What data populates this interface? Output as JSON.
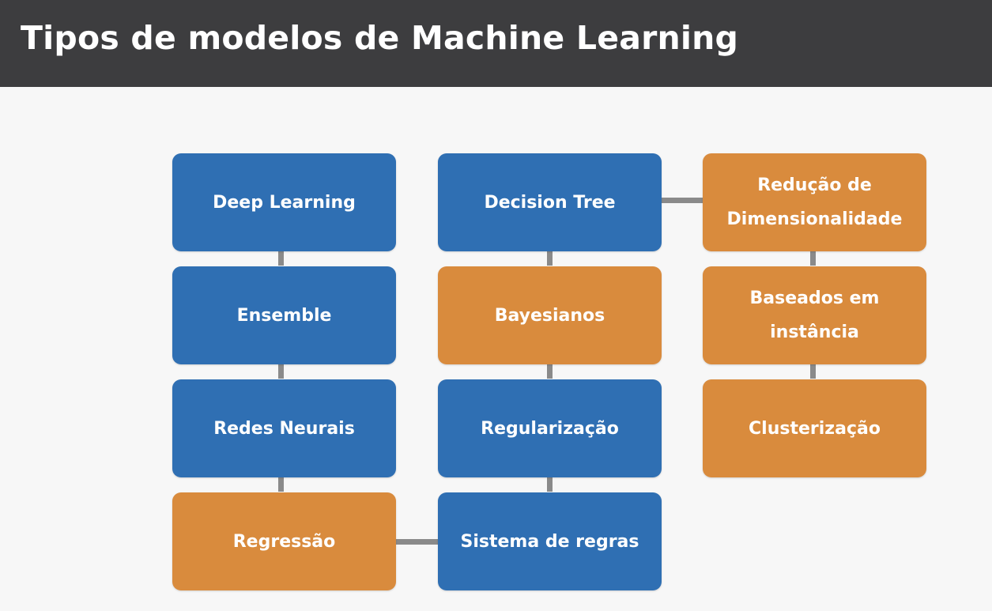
{
  "title": "Tipos de modelos de Machine Learning",
  "colors": {
    "header_bg": "#3d3d3f",
    "blue": "#2f6fb3",
    "orange": "#d98b3d",
    "connector": "#8a8a8a"
  },
  "nodes": {
    "deep_learning": {
      "label": "Deep Learning",
      "color": "blue"
    },
    "ensemble": {
      "label": "Ensemble",
      "color": "blue"
    },
    "redes_neurais": {
      "label": "Redes Neurais",
      "color": "blue"
    },
    "regressao": {
      "label": "Regressão",
      "color": "orange"
    },
    "decision_tree": {
      "label": "Decision Tree",
      "color": "blue"
    },
    "bayesianos": {
      "label": "Bayesianos",
      "color": "orange"
    },
    "regularizacao": {
      "label": "Regularização",
      "color": "blue"
    },
    "sistema_de_regras": {
      "label": "Sistema de regras",
      "color": "blue"
    },
    "reducao_de_dimensionalidade": {
      "label": "Redução de Dimensionalidade",
      "color": "orange"
    },
    "baseados_em_instancia": {
      "label": "Baseados em instância",
      "color": "orange"
    },
    "clusterizacao": {
      "label": "Clusterização",
      "color": "orange"
    }
  }
}
